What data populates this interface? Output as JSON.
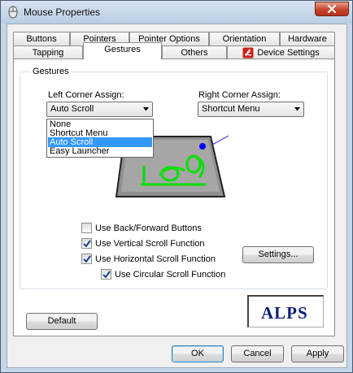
{
  "window": {
    "title": "Mouse Properties"
  },
  "tabs": {
    "row1": [
      {
        "label": "Buttons"
      },
      {
        "label": "Pointers"
      },
      {
        "label": "Pointer Options"
      },
      {
        "label": "Orientation"
      },
      {
        "label": "Hardware"
      }
    ],
    "row2": [
      {
        "label": "Tapping"
      },
      {
        "label": "Gestures",
        "active": true
      },
      {
        "label": "Others"
      },
      {
        "label": "Device Settings"
      }
    ]
  },
  "gestures": {
    "group_title": "Gestures",
    "left_corner": {
      "label": "Left Corner Assign:",
      "selected": "Auto Scroll",
      "options": [
        "None",
        "Shortcut Menu",
        "Auto Scroll",
        "Easy Launcher"
      ]
    },
    "right_corner": {
      "label": "Right Corner Assign:",
      "selected": "Shortcut Menu"
    },
    "checkboxes": [
      {
        "label": "Use Back/Forward Buttons",
        "checked": false
      },
      {
        "label": "Use Vertical Scroll Function",
        "checked": true
      },
      {
        "label": "Use Horizontal Scroll Function",
        "checked": true
      },
      {
        "label": "Use Circular Scroll Function",
        "checked": true
      }
    ],
    "settings_button": "Settings..."
  },
  "default_button": "Default",
  "logo_text": "ALPS",
  "footer": {
    "ok": "OK",
    "cancel": "Cancel",
    "apply": "Apply"
  },
  "colors": {
    "accent_selection": "#3399ff",
    "gesture_green": "#00e000",
    "corner_dot": "#0000ff",
    "logo": "#0a1f78",
    "close": "#c7442a"
  },
  "icons": {
    "title": "mouse-icon",
    "close": "close-icon",
    "device_settings": "pdf-icon"
  }
}
